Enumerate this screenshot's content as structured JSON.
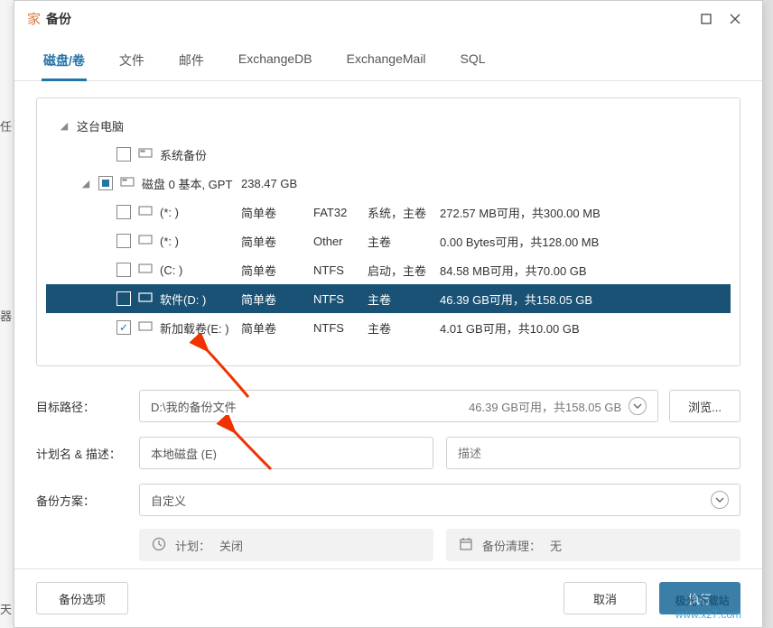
{
  "left_bg": {
    "char1": "任",
    "char2": "器",
    "char3": "天"
  },
  "window": {
    "title": "备份"
  },
  "tabs": [
    "磁盘/卷",
    "文件",
    "邮件",
    "ExchangeDB",
    "ExchangeMail",
    "SQL"
  ],
  "tree": {
    "root": {
      "label": "这台电脑"
    },
    "sys_backup": {
      "label": "系统备份"
    },
    "disk0": {
      "label": "磁盘 0 基本, GPT",
      "size": "238.47 GB"
    },
    "vols": [
      {
        "name": "(*: )",
        "type": "简单卷",
        "fs": "FAT32",
        "role": "系统，主卷",
        "space": "272.57 MB可用，共300.00 MB"
      },
      {
        "name": "(*: )",
        "type": "简单卷",
        "fs": "Other",
        "role": "主卷",
        "space": "0.00 Bytes可用，共128.00 MB"
      },
      {
        "name": "(C: )",
        "type": "简单卷",
        "fs": "NTFS",
        "role": "启动，主卷",
        "space": "84.58 MB可用，共70.00 GB"
      },
      {
        "name": "软件(D: )",
        "type": "简单卷",
        "fs": "NTFS",
        "role": "主卷",
        "space": "46.39 GB可用，共158.05 GB"
      },
      {
        "name": "新加载卷(E: )",
        "type": "简单卷",
        "fs": "NTFS",
        "role": "主卷",
        "space": "4.01 GB可用，共10.00 GB"
      }
    ]
  },
  "form": {
    "dest_label": "目标路径：",
    "dest_value": "D:\\我的备份文件",
    "dest_free": "46.39 GB可用，共158.05 GB",
    "browse": "浏览...",
    "plan_label": "计划名 & 描述：",
    "plan_value": "本地磁盘 (E)",
    "desc_placeholder": "描述",
    "scheme_label": "备份方案：",
    "scheme_value": "自定义",
    "schedule_label": "计划：",
    "schedule_value": "关闭",
    "cleanup_label": "备份清理：",
    "cleanup_value": "无"
  },
  "footer": {
    "options": "备份选项",
    "cancel": "取消",
    "execute": "执行"
  },
  "watermark": {
    "brand": "极光下载站",
    "url": "www.xz7.com"
  }
}
